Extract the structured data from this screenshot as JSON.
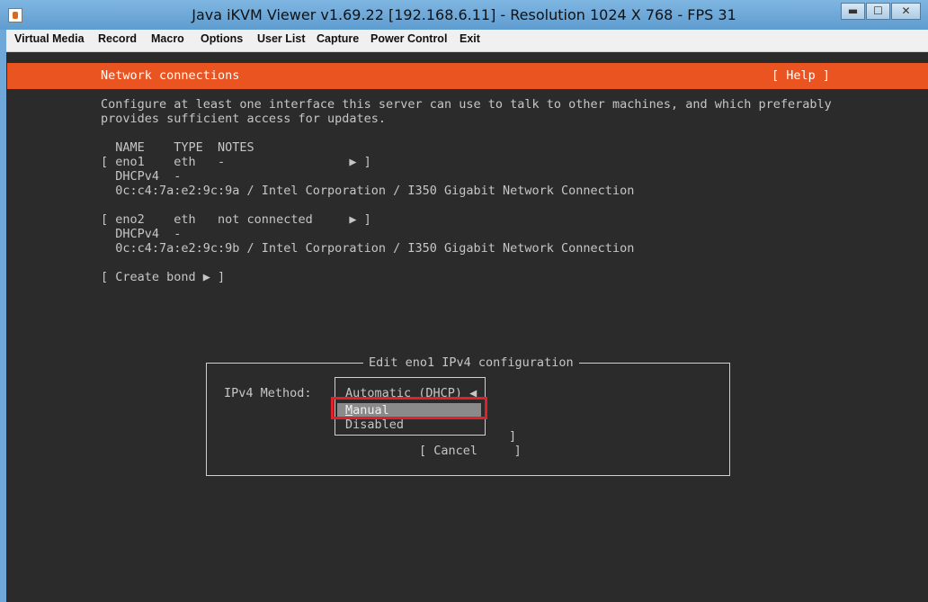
{
  "window": {
    "title": "Java iKVM Viewer v1.69.22 [192.168.6.11]  - Resolution 1024 X 768 - FPS 31",
    "minimize": "▬",
    "restore": "☐",
    "close": "✕"
  },
  "menu": [
    "Virtual Media",
    "Record",
    "Macro",
    "Options",
    "User List",
    "Capture",
    "Power Control",
    "Exit"
  ],
  "installer": {
    "header_title": "Network connections",
    "help": "[ Help ]",
    "description": [
      "Configure at least one interface this server can use to talk to other machines, and which preferably",
      "provides sufficient access for updates."
    ],
    "table_header": "  NAME    TYPE  NOTES",
    "interfaces": [
      {
        "row": "[ eno1    eth   -                 ▶ ]",
        "dhcp": "  DHCPv4  -",
        "hw": "  0c:c4:7a:e2:9c:9a / Intel Corporation / I350 Gigabit Network Connection"
      },
      {
        "row": "[ eno2    eth   not connected     ▶ ]",
        "dhcp": "  DHCPv4  -",
        "hw": "  0c:c4:7a:e2:9c:9b / Intel Corporation / I350 Gigabit Network Connection"
      }
    ],
    "create_bond": "[ Create bond ▶ ]"
  },
  "dialog": {
    "title": "Edit eno1 IPv4 configuration",
    "method_label": "IPv4 Method:",
    "options": [
      "Automatic (DHCP) ◀",
      "Manual",
      "Disabled"
    ],
    "selected_option": "Manual",
    "save_bracket": "]",
    "cancel": "[ Cancel     ]"
  },
  "colors": {
    "accent": "#e95420",
    "highlight_box": "#e0202a",
    "terminal_bg": "#2b2b2b"
  }
}
